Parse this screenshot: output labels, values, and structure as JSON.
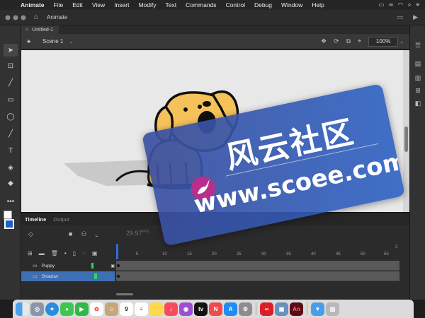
{
  "menubar": {
    "app_name": "Animate",
    "items": [
      "File",
      "Edit",
      "View",
      "Insert",
      "Modify",
      "Text",
      "Commands",
      "Control",
      "Debug",
      "Window",
      "Help"
    ]
  },
  "appbar": {
    "title": "Animate"
  },
  "document": {
    "tab_name": "Untitled-1"
  },
  "scene": {
    "name": "Scene 1",
    "zoom": "100%"
  },
  "timeline": {
    "tabs": [
      "Timeline",
      "Output"
    ],
    "fps": "29.97",
    "fps_unit": "FPS",
    "ruler": [
      "5",
      "10",
      "15",
      "20",
      "25",
      "30",
      "35",
      "40",
      "45",
      "50",
      "55"
    ],
    "ruler_small": "2",
    "layers": [
      {
        "name": "Puppy",
        "selected": false
      },
      {
        "name": "Shadow",
        "selected": true
      }
    ]
  },
  "watermark": {
    "text_cn": "风云社区",
    "url": "www.scoee.com"
  },
  "dock": {
    "apps": [
      "finder",
      "launchpad",
      "safari",
      "messages",
      "facetime",
      "photos",
      "contacts",
      "calendar",
      "reminders",
      "notes",
      "music",
      "podcasts",
      "tv",
      "news",
      "app-store",
      "system-preferences",
      "creative-cloud",
      "preview",
      "animate",
      "downloads",
      "trash"
    ],
    "calendar_day": "9",
    "animate_label": "An",
    "tv_label": "tv"
  },
  "colors": {
    "stage": "#e8e8e8",
    "fill_swatch": "#1f5fc4",
    "selected_layer": "#3e6fb5",
    "playhead": "#2d6be6",
    "dog_body": "#f5c25a"
  }
}
